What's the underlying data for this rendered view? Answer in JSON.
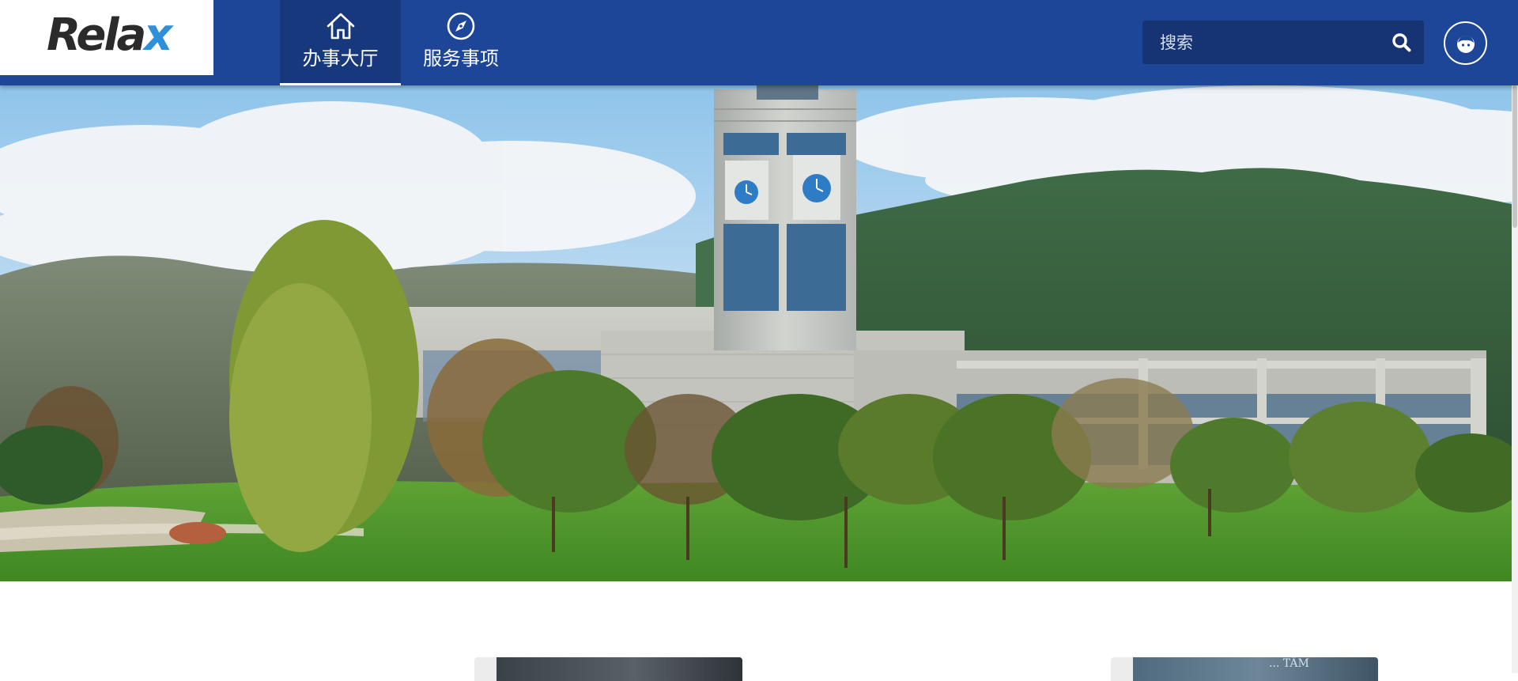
{
  "header": {
    "logo": {
      "text_main": "Rela",
      "text_accent": "x"
    },
    "nav": [
      {
        "label": "办事大厅",
        "icon": "home-icon",
        "active": true
      },
      {
        "label": "服务事项",
        "icon": "compass-icon",
        "active": false
      }
    ],
    "search": {
      "placeholder": "搜索",
      "value": "",
      "icon": "search-icon"
    },
    "user": {
      "icon": "user-avatar-icon"
    }
  },
  "hero": {
    "image": "banner-photo-government-building-mountains"
  },
  "cards": [
    {
      "name": "service-card-1",
      "image": "dark-photo"
    },
    {
      "name": "service-card-2",
      "image": "chalkboard-photo",
      "text": "... TÂM"
    }
  ],
  "colors": {
    "header_bg": "#1d4699",
    "active_nav_bg": "#17387d",
    "search_bg": "#163473"
  }
}
